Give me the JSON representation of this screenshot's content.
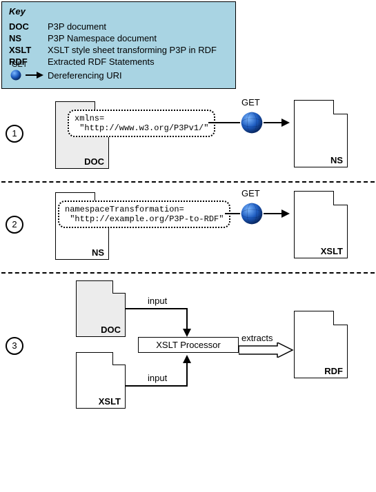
{
  "key": {
    "title": "Key",
    "items": [
      {
        "term": "DOC",
        "desc": "P3P document"
      },
      {
        "term": "NS",
        "desc": "P3P Namespace document"
      },
      {
        "term": "XSLT",
        "desc": "XSLT style sheet transforming P3P in RDF"
      },
      {
        "term": "RDF",
        "desc": "Extracted RDF Statements"
      }
    ],
    "arrow": {
      "label": "GET",
      "desc": "Dereferencing URI"
    }
  },
  "steps": {
    "s1": {
      "num": "1",
      "file_left": "DOC",
      "snippet": "xmlns=\n \"http://www.w3.org/P3Pv1/\"",
      "get": "GET",
      "file_right": "NS"
    },
    "s2": {
      "num": "2",
      "file_left": "NS",
      "snippet": "namespaceTransformation=\n \"http://example.org/P3P-to-RDF\"",
      "get": "GET",
      "file_right": "XSLT"
    },
    "s3": {
      "num": "3",
      "file_top": "DOC",
      "file_bottom": "XSLT",
      "input_label": "input",
      "processor": "XSLT Processor",
      "extracts": "extracts",
      "file_right": "RDF"
    }
  }
}
